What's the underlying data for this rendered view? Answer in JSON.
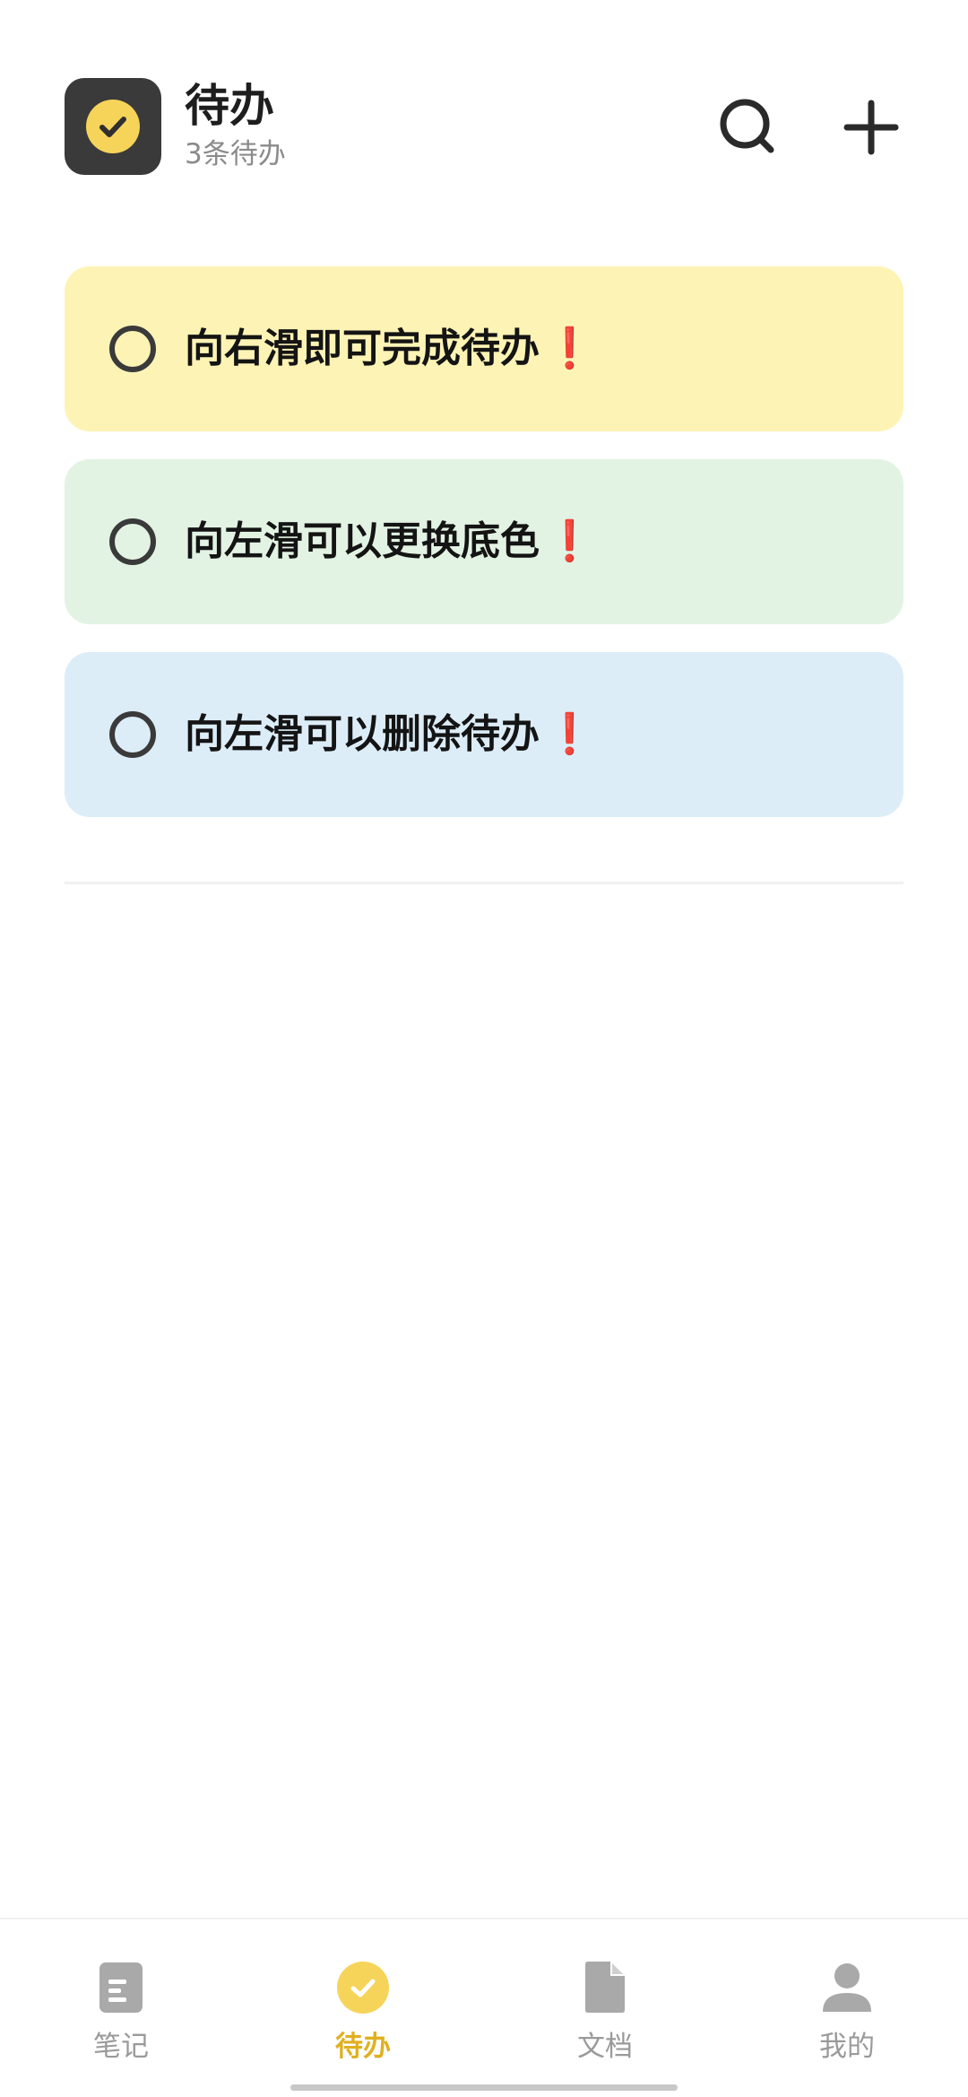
{
  "header": {
    "title": "待办",
    "subtitle": "3条待办",
    "app_icon": "check-circle-icon",
    "actions": [
      {
        "name": "search",
        "icon": "search-icon"
      },
      {
        "name": "add",
        "icon": "plus-icon"
      }
    ]
  },
  "todos": [
    {
      "text": "向右滑即可完成待办",
      "flag": "❗",
      "color": "#fdf3b5"
    },
    {
      "text": "向左滑可以更换底色",
      "flag": "❗",
      "color": "#e2f3e3"
    },
    {
      "text": "向左滑可以删除待办",
      "flag": "❗",
      "color": "#dcedf8"
    }
  ],
  "bottom_nav": {
    "items": [
      {
        "label": "笔记",
        "icon": "note-icon",
        "active": false
      },
      {
        "label": "待办",
        "icon": "todo-check-icon",
        "active": true
      },
      {
        "label": "文档",
        "icon": "document-icon",
        "active": false
      },
      {
        "label": "我的",
        "icon": "profile-icon",
        "active": false
      }
    ]
  },
  "colors": {
    "accent": "#f6d45a",
    "active_label": "#e0b020",
    "flag": "#ef6b6b"
  }
}
